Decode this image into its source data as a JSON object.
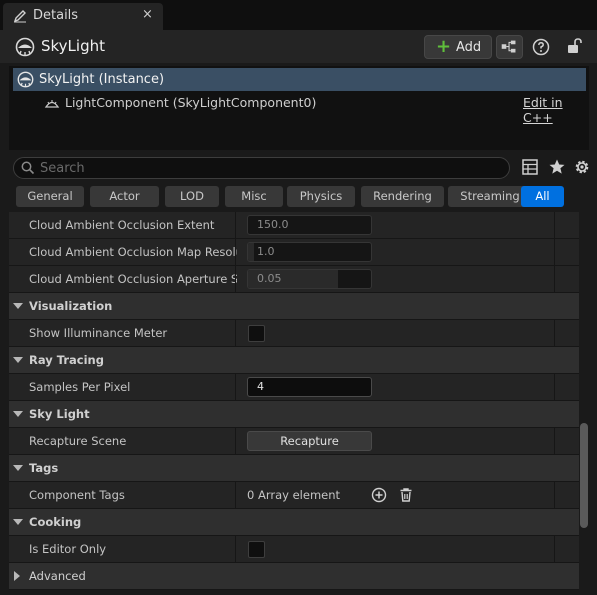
{
  "tab": {
    "title": "Details",
    "close": "×"
  },
  "header": {
    "actor_name": "SkyLight",
    "add_label": "Add"
  },
  "tree": {
    "instance": "SkyLight (Instance)",
    "component": "LightComponent (SkyLightComponent0)",
    "edit_link": "Edit in C++"
  },
  "search": {
    "placeholder": "Search",
    "value": ""
  },
  "filters": [
    "General",
    "Actor",
    "LOD",
    "Misc",
    "Physics",
    "Rendering",
    "Streaming",
    "All"
  ],
  "active_filter": "All",
  "properties": {
    "cloud_ao_extent": {
      "label": "Cloud Ambient Occlusion Extent",
      "value": "150.0",
      "fill": 0.0
    },
    "cloud_ao_map_res": {
      "label": "Cloud Ambient Occlusion Map Resoluti…",
      "value": "1.0",
      "fill": 0.05
    },
    "cloud_ao_aperture": {
      "label": "Cloud Ambient Occlusion Aperture Scale",
      "value": "0.05",
      "fill": 0.72
    },
    "visualization": {
      "label": "Visualization"
    },
    "show_illuminance": {
      "label": "Show Illuminance Meter",
      "checked": false
    },
    "ray_tracing": {
      "label": "Ray Tracing"
    },
    "samples_per_pixel": {
      "label": "Samples Per Pixel",
      "value": "4"
    },
    "sky_light": {
      "label": "Sky Light"
    },
    "recapture_scene": {
      "label": "Recapture Scene",
      "button": "Recapture"
    },
    "tags": {
      "label": "Tags"
    },
    "component_tags": {
      "label": "Component Tags",
      "value": "0 Array element"
    },
    "cooking": {
      "label": "Cooking"
    },
    "is_editor_only": {
      "label": "Is Editor Only",
      "checked": false
    },
    "advanced": {
      "label": "Advanced"
    }
  },
  "colors": {
    "accent": "#0070e0",
    "selection": "#3a4f64",
    "add_plus": "#5fbf3b"
  },
  "icons": [
    "pencil-icon",
    "skylight-icon",
    "plus-icon",
    "blueprint-icon",
    "help-icon",
    "lock-icon",
    "search-icon",
    "grid-icon",
    "star-icon",
    "gear-icon",
    "add-element-icon",
    "trash-icon"
  ]
}
